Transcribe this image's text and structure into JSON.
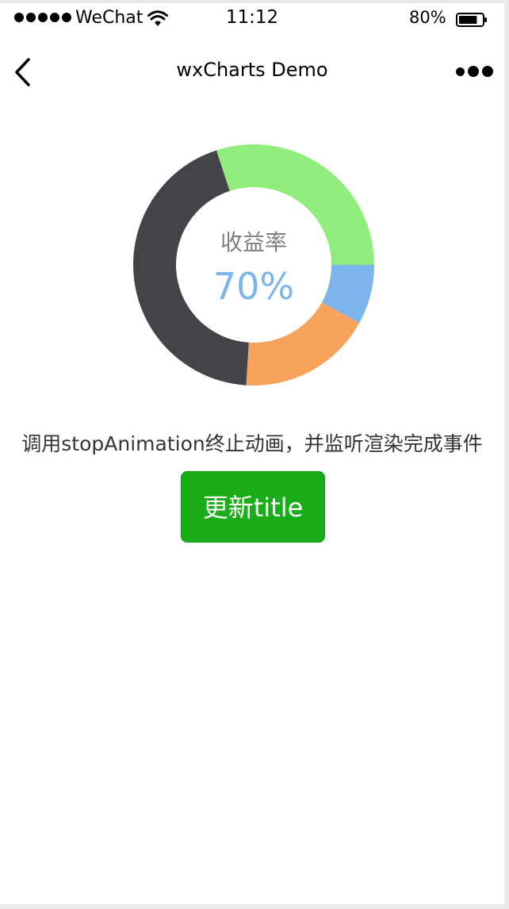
{
  "status_bar": {
    "carrier": "WeChat",
    "time": "11:12",
    "battery": "80%",
    "battery_level": 0.8,
    "signal_dots": 5
  },
  "nav": {
    "title": "wxCharts Demo",
    "back_icon": "chevron-left-icon",
    "more_icon": "more-dots-icon"
  },
  "chart_data": {
    "type": "pie",
    "variant": "ring",
    "title": "收益率",
    "subtitle": "70%",
    "series": [
      {
        "value": 8,
        "color": "#7cb5ec"
      },
      {
        "value": 18,
        "color": "#f7a35c"
      },
      {
        "value": 44,
        "color": "#434348"
      },
      {
        "value": 30,
        "color": "#90ed7d"
      }
    ],
    "colors": {
      "title": "#7f7f7f",
      "subtitle": "#7cb5ec"
    }
  },
  "main": {
    "description": "调用stopAnimation终止动画，并监听渲染完成事件",
    "update_button_label": "更新title"
  },
  "colors": {
    "button_bg": "#1aad19",
    "button_text": "#ffffff"
  }
}
